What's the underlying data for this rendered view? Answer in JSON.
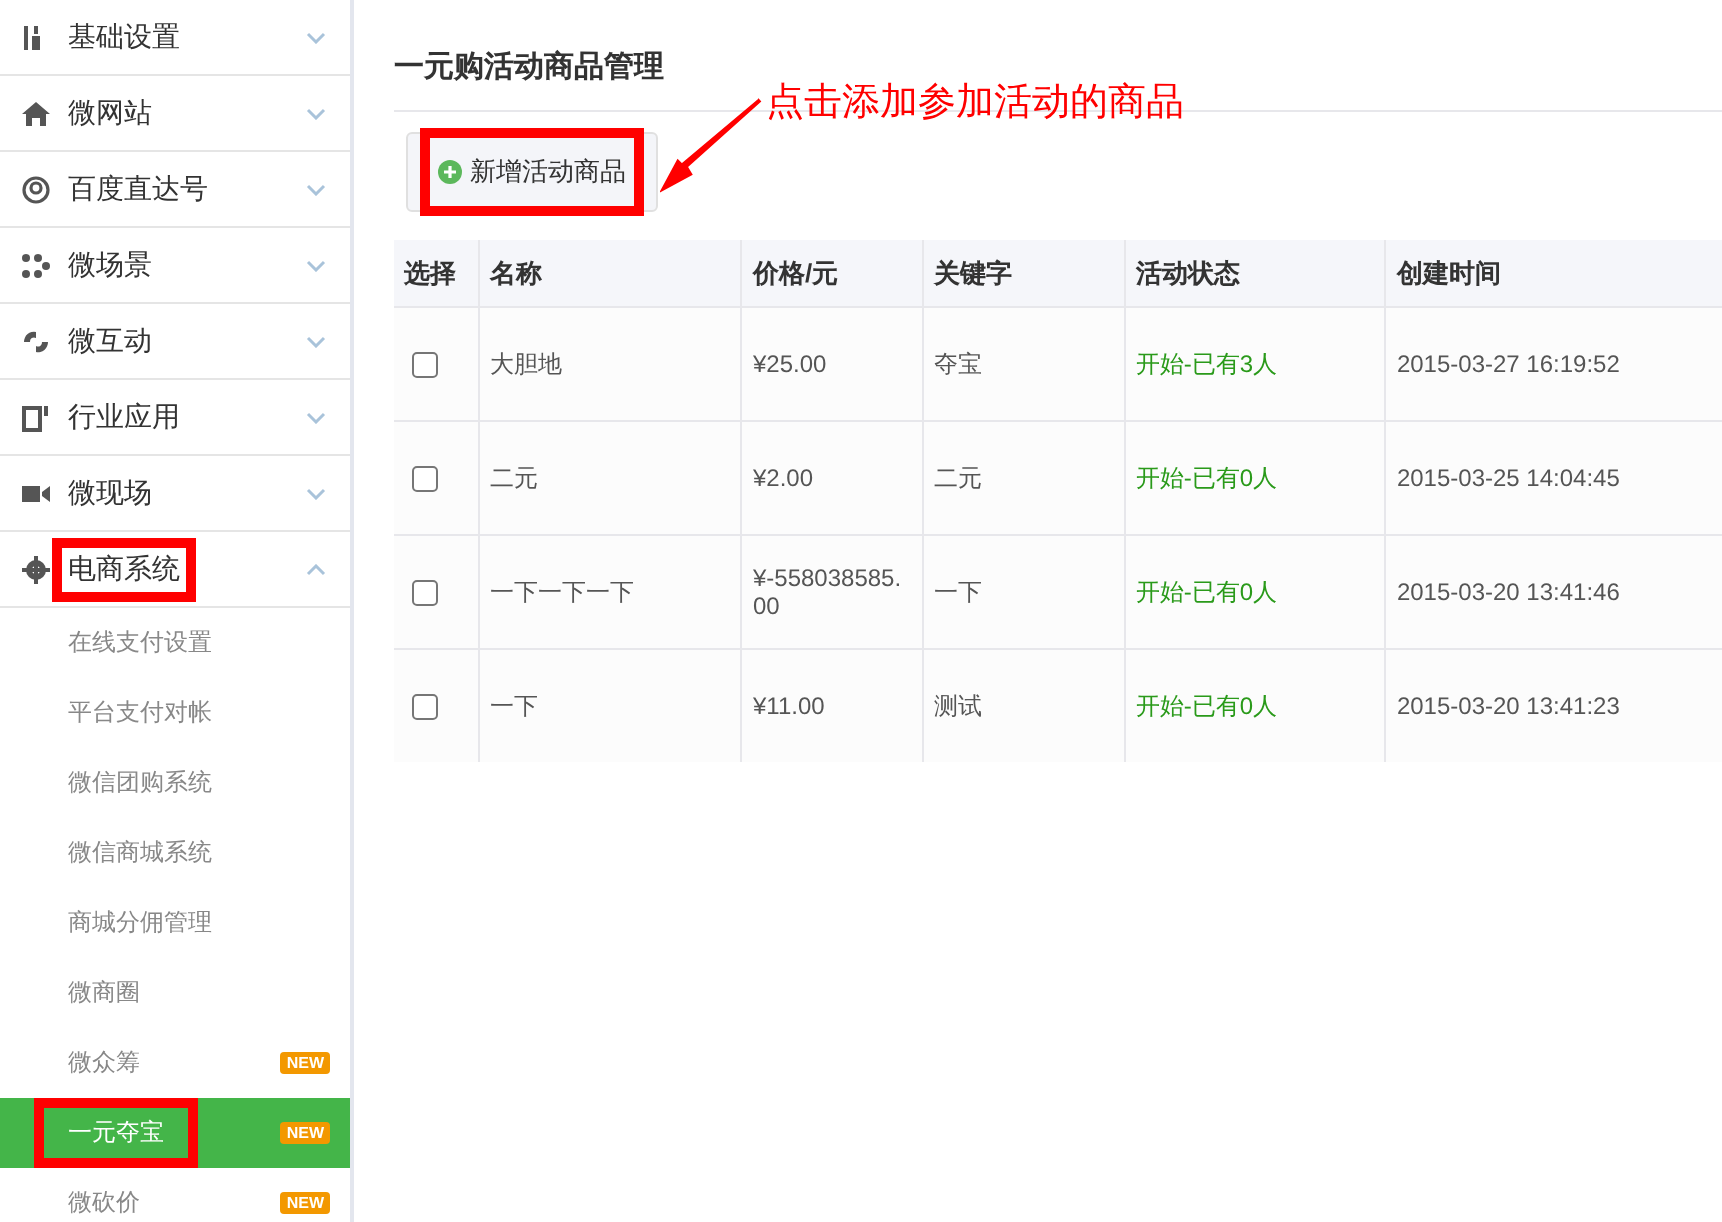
{
  "sidebar": {
    "menus": [
      {
        "label": "基础设置",
        "expanded": false,
        "annotated": false
      },
      {
        "label": "微网站",
        "expanded": false,
        "annotated": false
      },
      {
        "label": "百度直达号",
        "expanded": false,
        "annotated": false
      },
      {
        "label": "微场景",
        "expanded": false,
        "annotated": false
      },
      {
        "label": "微互动",
        "expanded": false,
        "annotated": false
      },
      {
        "label": "行业应用",
        "expanded": false,
        "annotated": false
      },
      {
        "label": "微现场",
        "expanded": false,
        "annotated": false
      },
      {
        "label": "电商系统",
        "expanded": true,
        "annotated": true,
        "children": [
          {
            "label": "在线支付设置",
            "selected": false,
            "annotated": false
          },
          {
            "label": "平台支付对帐",
            "selected": false,
            "annotated": false
          },
          {
            "label": "微信团购系统",
            "selected": false,
            "annotated": false
          },
          {
            "label": "微信商城系统",
            "selected": false,
            "annotated": false
          },
          {
            "label": "商城分佣管理",
            "selected": false,
            "annotated": false
          },
          {
            "label": "微商圈",
            "selected": false,
            "annotated": false
          },
          {
            "label": "微众筹",
            "selected": false,
            "annotated": false,
            "badge": "NEW"
          },
          {
            "label": "一元夺宝",
            "selected": true,
            "annotated": true,
            "badge": "NEW"
          },
          {
            "label": "微砍价",
            "selected": false,
            "annotated": false,
            "badge": "NEW"
          }
        ]
      }
    ]
  },
  "page": {
    "title": "一元购活动商品管理",
    "add_button": {
      "label": "新增活动商品",
      "annotated": true
    },
    "annotation": "点击添加参加活动的商品"
  },
  "table": {
    "columns": [
      "选择",
      "名称",
      "价格/元",
      "关键字",
      "活动状态",
      "创建时间"
    ],
    "rows": [
      {
        "checked": false,
        "name": "大胆地",
        "price": "¥25.00",
        "keyword": "夺宝",
        "status": "开始-已有3人",
        "created": "2015-03-27 16:19:52"
      },
      {
        "checked": false,
        "name": "二元",
        "price": "¥2.00",
        "keyword": "二元",
        "status": "开始-已有0人",
        "created": "2015-03-25 14:04:45"
      },
      {
        "checked": false,
        "name": "一下一下一下",
        "price": "¥-558038585.00",
        "keyword": "一下",
        "status": "开始-已有0人",
        "created": "2015-03-20 13:41:46"
      },
      {
        "checked": false,
        "name": "一下",
        "price": "¥11.00",
        "keyword": "测试",
        "status": "开始-已有0人",
        "created": "2015-03-20 13:41:23"
      }
    ]
  }
}
